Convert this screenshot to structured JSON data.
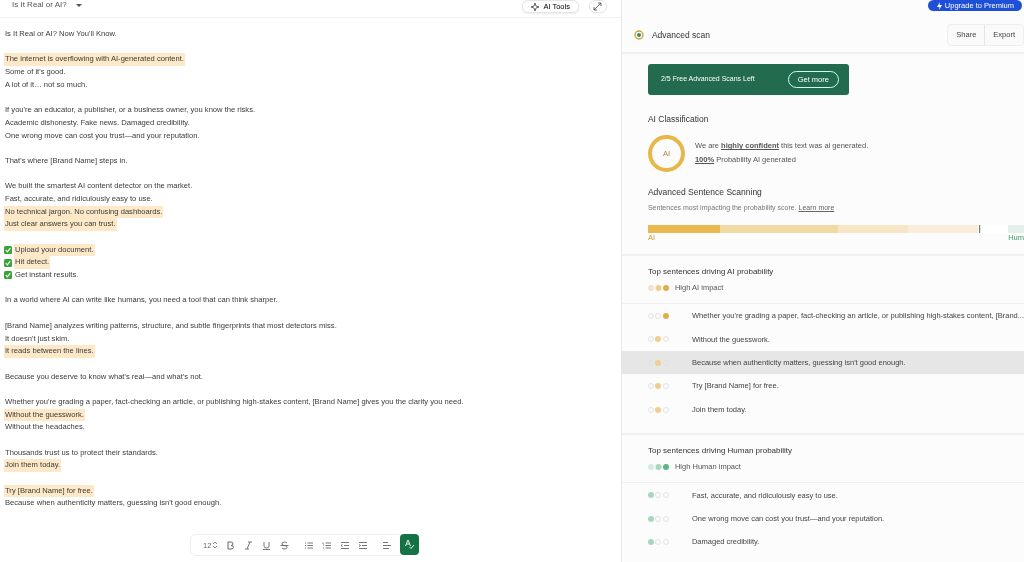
{
  "editor": {
    "doc_title": "Is It Real or AI?",
    "ai_tools_label": "AI Tools",
    "paragraphs": [
      {
        "lines": [
          {
            "text": "Is It Real or AI? Now You'll Know.",
            "highlighted": false,
            "kind": "text"
          }
        ]
      },
      {
        "lines": [
          {
            "text": "The internet is overflowing with AI-generated content.",
            "highlighted": true,
            "kind": "text"
          },
          {
            "text": "Some of it's good.",
            "highlighted": false,
            "kind": "text"
          },
          {
            "text": "A lot of it… not so much.",
            "highlighted": false,
            "kind": "text"
          }
        ]
      },
      {
        "lines": [
          {
            "text": "If you're an educator, a publisher, or a business owner, you know the risks.",
            "highlighted": false,
            "kind": "text"
          },
          {
            "text": "Academic dishonesty. Fake news. Damaged credibility.",
            "highlighted": false,
            "kind": "text"
          },
          {
            "text": "One wrong move can cost you trust—and your reputation.",
            "highlighted": false,
            "kind": "text"
          }
        ]
      },
      {
        "lines": [
          {
            "text": "That's where [Brand Name] steps in.",
            "highlighted": false,
            "kind": "text"
          }
        ]
      },
      {
        "lines": [
          {
            "text": "We built the smartest AI content detector on the market.",
            "highlighted": false,
            "kind": "text"
          },
          {
            "text": "Fast, accurate, and ridiculously easy to use.",
            "highlighted": false,
            "kind": "text"
          },
          {
            "text": "No technical jargon. No confusing dashboards.",
            "highlighted": true,
            "kind": "text"
          },
          {
            "text": "Just clear answers you can trust.",
            "highlighted": true,
            "kind": "text"
          }
        ]
      },
      {
        "lines": [
          {
            "text": "Upload your document.",
            "highlighted": true,
            "kind": "check"
          },
          {
            "text": "Hit detect.",
            "highlighted": true,
            "kind": "check"
          },
          {
            "text": "Get instant results.",
            "highlighted": false,
            "kind": "check"
          }
        ]
      },
      {
        "lines": [
          {
            "text": "In a world where AI can write like humans, you need a tool that can think sharper.",
            "highlighted": false,
            "kind": "text"
          }
        ]
      },
      {
        "lines": [
          {
            "text": "[Brand Name] analyzes writing patterns, structure, and subtle fingerprints that most detectors miss.",
            "highlighted": false,
            "kind": "text"
          },
          {
            "text": "It doesn't just skim.",
            "highlighted": false,
            "kind": "text"
          },
          {
            "text": "It reads between the lines.",
            "highlighted": true,
            "kind": "text"
          }
        ]
      },
      {
        "lines": [
          {
            "text": "Because you deserve to know what's real—and what's not.",
            "highlighted": false,
            "kind": "text"
          }
        ]
      },
      {
        "lines": [
          {
            "text": "Whether you're grading a paper, fact-checking an article, or publishing high-stakes content, [Brand Name] gives you the clarity you need.",
            "highlighted": false,
            "kind": "text"
          },
          {
            "text": "Without the guesswork.",
            "highlighted": true,
            "kind": "text"
          },
          {
            "text": "Without the headaches.",
            "highlighted": false,
            "kind": "text"
          }
        ]
      },
      {
        "lines": [
          {
            "text": "Thousands trust us to protect their standards.",
            "highlighted": false,
            "kind": "text"
          },
          {
            "text": "Join them today.",
            "highlighted": true,
            "kind": "text"
          }
        ]
      },
      {
        "lines": [
          {
            "text": "Try [Brand Name] for free.",
            "highlighted": true,
            "kind": "text"
          },
          {
            "text": "Because when authenticity matters, guessing isn't good enough.",
            "highlighted": false,
            "kind": "text"
          }
        ]
      }
    ],
    "toolbar": {
      "font_size": "12"
    }
  },
  "panel": {
    "upgrade_label": "Upgrade to Premium",
    "title": "Advanced scan",
    "share_label": "Share",
    "export_label": "Export",
    "banner": {
      "text": "2/5 Free Advanced Scans Left",
      "button": "Get more"
    },
    "classification": {
      "heading": "AI Classification",
      "badge": "AI",
      "statement": "We are **highly confident** this text was ai generated.",
      "probability": "**100%** Probability AI generated"
    },
    "scanning": {
      "heading": "Advanced Sentence Scanning",
      "subtext": "Sentences most impacting the probability score.",
      "link": "Learn more",
      "left_label": "AI",
      "right_label": "Hum"
    },
    "groups": [
      {
        "kind": "ai",
        "heading": "Top sentences driving AI probability",
        "legend": "High AI impact",
        "sentences": [
          {
            "text": "Whether you're grading a paper, fact-checking an article, or publishing high-stakes content, [Brand...",
            "dots": [
              {
                "filled": false
              },
              {
                "filled": false
              },
              {
                "filled": true
              }
            ],
            "selected": false
          },
          {
            "text": "Without the guesswork.",
            "dots": [
              {
                "filled": false
              },
              {
                "filled": true
              },
              {
                "filled": false
              }
            ],
            "selected": false
          },
          {
            "text": "Because when authenticity matters, guessing isn't good enough.",
            "dots": [
              {
                "filled": false
              },
              {
                "filled": true
              },
              {
                "filled": false
              }
            ],
            "selected": true
          },
          {
            "text": "Try [Brand Name] for free.",
            "dots": [
              {
                "filled": false
              },
              {
                "filled": true
              },
              {
                "filled": false
              }
            ],
            "selected": false
          },
          {
            "text": "Join them today.",
            "dots": [
              {
                "filled": false
              },
              {
                "filled": true
              },
              {
                "filled": false
              }
            ],
            "selected": false
          }
        ]
      },
      {
        "kind": "human",
        "heading": "Top sentences driving Human probability",
        "legend": "High Human impact",
        "sentences": [
          {
            "text": "Fast, accurate, and ridiculously easy to use.",
            "dots": [
              {
                "filled": true
              },
              {
                "filled": false
              },
              {
                "filled": false
              }
            ],
            "selected": false
          },
          {
            "text": "One wrong move can cost you trust—and your reputation.",
            "dots": [
              {
                "filled": true
              },
              {
                "filled": false
              },
              {
                "filled": false
              }
            ],
            "selected": false
          },
          {
            "text": "Damaged credibility.",
            "dots": [
              {
                "filled": true
              },
              {
                "filled": false
              },
              {
                "filled": false
              }
            ],
            "selected": false
          }
        ]
      }
    ]
  }
}
